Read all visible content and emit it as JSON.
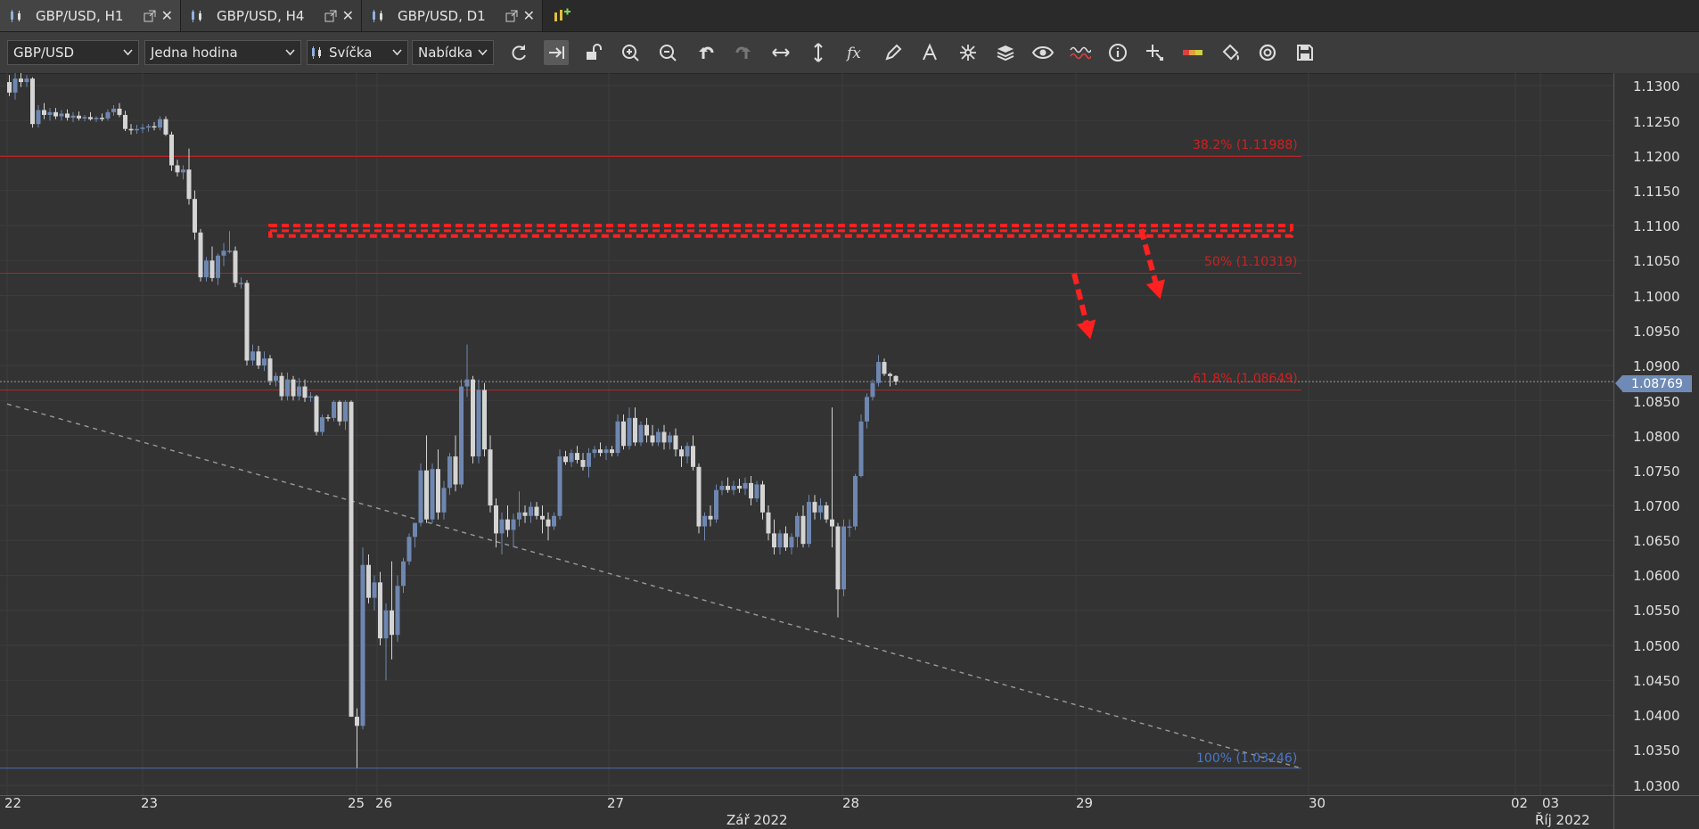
{
  "tabs": [
    {
      "label": "GBP/USD, H1",
      "active": true
    },
    {
      "label": "GBP/USD, H4",
      "active": false
    },
    {
      "label": "GBP/USD, D1",
      "active": false
    }
  ],
  "toolbar": {
    "symbol": "GBP/USD",
    "timeframe": "Jedna hodina",
    "chart_type": "Svíčka",
    "price_type": "Nabídka",
    "tools": [
      "refresh-icon",
      "autoscroll-icon",
      "lock-icon",
      "zoom-in-icon",
      "zoom-out-icon",
      "undo-icon",
      "redo-icon",
      "horizontal-resize-icon",
      "vertical-resize-icon",
      "indicator-fx-icon",
      "pencil-icon",
      "text-icon",
      "crosshair-star-icon",
      "layers-icon",
      "eye-icon",
      "waves-icon",
      "info-icon",
      "cursor-cross-icon",
      "color-bar-icon",
      "paint-bucket-icon",
      "camera-icon",
      "save-icon"
    ]
  },
  "price_axis": {
    "labels": [
      "1.1300",
      "1.1250",
      "1.1200",
      "1.1150",
      "1.1100",
      "1.1050",
      "1.1000",
      "1.0950",
      "1.0900",
      "1.0850",
      "1.0800",
      "1.0750",
      "1.0700",
      "1.0650",
      "1.0600",
      "1.0550",
      "1.0500",
      "1.0450",
      "1.0400",
      "1.0350",
      "1.0300"
    ],
    "current_price": "1.08769"
  },
  "time_axis": {
    "labels": [
      "22",
      "23",
      "25",
      "26",
      "27",
      "28",
      "29",
      "30",
      "02",
      "03"
    ],
    "months": [
      "Zář 2022",
      "Říj 2022"
    ]
  },
  "fib_labels": {
    "f382": "38.2% (1.11988)",
    "f50": "50% (1.10319)",
    "f618": "61.8% (1.08649)",
    "f100": "100% (1.03246)"
  },
  "colors": {
    "background": "#333333",
    "bull": "#6e87b0",
    "bear": "#d4d4d4",
    "fib": "#cc2222",
    "resistance": "#ff2020",
    "fib100": "#4a78c8",
    "trendline": "#9a9a9a"
  },
  "chart_data": {
    "type": "candlestick",
    "ylim": [
      1.0285,
      1.1325
    ],
    "x_domain": [
      "22",
      "03"
    ],
    "fib_levels": [
      1.11988,
      1.10319,
      1.08649,
      1.03246
    ],
    "resistance_zone": [
      1.1085,
      1.11
    ],
    "trendline": {
      "from": {
        "i": 0,
        "p": 1.0845
      },
      "to": {
        "i": 184,
        "p": 1.0325
      }
    },
    "candles": [
      {
        "o": 1.1305,
        "h": 1.1315,
        "l": 1.1285,
        "c": 1.129
      },
      {
        "o": 1.129,
        "h": 1.1318,
        "l": 1.128,
        "c": 1.131
      },
      {
        "o": 1.131,
        "h": 1.1318,
        "l": 1.1298,
        "c": 1.1305
      },
      {
        "o": 1.1305,
        "h": 1.1315,
        "l": 1.1298,
        "c": 1.131
      },
      {
        "o": 1.131,
        "h": 1.1312,
        "l": 1.124,
        "c": 1.1245
      },
      {
        "o": 1.1245,
        "h": 1.1272,
        "l": 1.124,
        "c": 1.1265
      },
      {
        "o": 1.1265,
        "h": 1.1275,
        "l": 1.1252,
        "c": 1.1258
      },
      {
        "o": 1.1258,
        "h": 1.1268,
        "l": 1.125,
        "c": 1.1262
      },
      {
        "o": 1.1262,
        "h": 1.1268,
        "l": 1.1252,
        "c": 1.1256
      },
      {
        "o": 1.1256,
        "h": 1.1265,
        "l": 1.125,
        "c": 1.126
      },
      {
        "o": 1.126,
        "h": 1.1266,
        "l": 1.125,
        "c": 1.1254
      },
      {
        "o": 1.1254,
        "h": 1.1262,
        "l": 1.1248,
        "c": 1.1257
      },
      {
        "o": 1.1257,
        "h": 1.1263,
        "l": 1.125,
        "c": 1.1253
      },
      {
        "o": 1.1253,
        "h": 1.1258,
        "l": 1.1249,
        "c": 1.1255
      },
      {
        "o": 1.1255,
        "h": 1.1262,
        "l": 1.125,
        "c": 1.1252
      },
      {
        "o": 1.1252,
        "h": 1.1256,
        "l": 1.1248,
        "c": 1.1254
      },
      {
        "o": 1.1254,
        "h": 1.126,
        "l": 1.1249,
        "c": 1.1253
      },
      {
        "o": 1.1253,
        "h": 1.1266,
        "l": 1.125,
        "c": 1.1262
      },
      {
        "o": 1.1262,
        "h": 1.1272,
        "l": 1.1257,
        "c": 1.1267
      },
      {
        "o": 1.1267,
        "h": 1.1275,
        "l": 1.1255,
        "c": 1.1258
      },
      {
        "o": 1.1258,
        "h": 1.1264,
        "l": 1.1235,
        "c": 1.1238
      },
      {
        "o": 1.1238,
        "h": 1.1245,
        "l": 1.123,
        "c": 1.1236
      },
      {
        "o": 1.1236,
        "h": 1.1244,
        "l": 1.1231,
        "c": 1.1238
      },
      {
        "o": 1.1238,
        "h": 1.1245,
        "l": 1.1232,
        "c": 1.124
      },
      {
        "o": 1.124,
        "h": 1.1245,
        "l": 1.1234,
        "c": 1.1242
      },
      {
        "o": 1.1242,
        "h": 1.1248,
        "l": 1.1236,
        "c": 1.124
      },
      {
        "o": 1.124,
        "h": 1.1256,
        "l": 1.1236,
        "c": 1.1252
      },
      {
        "o": 1.1252,
        "h": 1.1256,
        "l": 1.1228,
        "c": 1.123
      },
      {
        "o": 1.123,
        "h": 1.1234,
        "l": 1.1178,
        "c": 1.1186
      },
      {
        "o": 1.1186,
        "h": 1.1194,
        "l": 1.117,
        "c": 1.1176
      },
      {
        "o": 1.1176,
        "h": 1.1186,
        "l": 1.1166,
        "c": 1.118
      },
      {
        "o": 1.118,
        "h": 1.121,
        "l": 1.113,
        "c": 1.1138
      },
      {
        "o": 1.1138,
        "h": 1.115,
        "l": 1.108,
        "c": 1.109
      },
      {
        "o": 1.109,
        "h": 1.1095,
        "l": 1.102,
        "c": 1.1026
      },
      {
        "o": 1.1026,
        "h": 1.1055,
        "l": 1.102,
        "c": 1.105
      },
      {
        "o": 1.105,
        "h": 1.107,
        "l": 1.102,
        "c": 1.1025
      },
      {
        "o": 1.1025,
        "h": 1.106,
        "l": 1.1015,
        "c": 1.1057
      },
      {
        "o": 1.1057,
        "h": 1.1075,
        "l": 1.1042,
        "c": 1.1064
      },
      {
        "o": 1.1064,
        "h": 1.1092,
        "l": 1.106,
        "c": 1.1064
      },
      {
        "o": 1.1064,
        "h": 1.107,
        "l": 1.1012,
        "c": 1.1018
      },
      {
        "o": 1.1018,
        "h": 1.1026,
        "l": 1.101,
        "c": 1.1018
      },
      {
        "o": 1.1018,
        "h": 1.1022,
        "l": 1.09,
        "c": 1.0907
      },
      {
        "o": 1.0907,
        "h": 1.093,
        "l": 1.09,
        "c": 1.092
      },
      {
        "o": 1.092,
        "h": 1.0928,
        "l": 1.0895,
        "c": 1.09
      },
      {
        "o": 1.09,
        "h": 1.092,
        "l": 1.0892,
        "c": 1.091
      },
      {
        "o": 1.091,
        "h": 1.0915,
        "l": 1.0872,
        "c": 1.0878
      },
      {
        "o": 1.0878,
        "h": 1.089,
        "l": 1.087,
        "c": 1.0885
      },
      {
        "o": 1.0885,
        "h": 1.089,
        "l": 1.085,
        "c": 1.0856
      },
      {
        "o": 1.0856,
        "h": 1.089,
        "l": 1.085,
        "c": 1.088
      },
      {
        "o": 1.088,
        "h": 1.0885,
        "l": 1.085,
        "c": 1.0856
      },
      {
        "o": 1.0856,
        "h": 1.0882,
        "l": 1.085,
        "c": 1.087
      },
      {
        "o": 1.087,
        "h": 1.088,
        "l": 1.0848,
        "c": 1.0854
      },
      {
        "o": 1.0854,
        "h": 1.0862,
        "l": 1.0848,
        "c": 1.0856
      },
      {
        "o": 1.0856,
        "h": 1.0858,
        "l": 1.08,
        "c": 1.0805
      },
      {
        "o": 1.0805,
        "h": 1.083,
        "l": 1.08,
        "c": 1.0826
      },
      {
        "o": 1.0826,
        "h": 1.083,
        "l": 1.082,
        "c": 1.0825
      },
      {
        "o": 1.0825,
        "h": 1.085,
        "l": 1.082,
        "c": 1.0848
      },
      {
        "o": 1.0848,
        "h": 1.085,
        "l": 1.0814,
        "c": 1.082
      },
      {
        "o": 1.082,
        "h": 1.085,
        "l": 1.0808,
        "c": 1.0848
      },
      {
        "o": 1.0848,
        "h": 1.085,
        "l": 1.0398,
        "c": 1.0398
      },
      {
        "o": 1.0398,
        "h": 1.041,
        "l": 1.0325,
        "c": 1.0385
      },
      {
        "o": 1.0385,
        "h": 1.064,
        "l": 1.038,
        "c": 1.0615
      },
      {
        "o": 1.0615,
        "h": 1.063,
        "l": 1.056,
        "c": 1.0568
      },
      {
        "o": 1.0568,
        "h": 1.06,
        "l": 1.055,
        "c": 1.059
      },
      {
        "o": 1.059,
        "h": 1.0605,
        "l": 1.05,
        "c": 1.051
      },
      {
        "o": 1.051,
        "h": 1.056,
        "l": 1.045,
        "c": 1.055
      },
      {
        "o": 1.055,
        "h": 1.062,
        "l": 1.048,
        "c": 1.0515
      },
      {
        "o": 1.0515,
        "h": 1.06,
        "l": 1.0505,
        "c": 1.0585
      },
      {
        "o": 1.0585,
        "h": 1.0625,
        "l": 1.0575,
        "c": 1.062
      },
      {
        "o": 1.062,
        "h": 1.066,
        "l": 1.0615,
        "c": 1.0655
      },
      {
        "o": 1.0655,
        "h": 1.0675,
        "l": 1.064,
        "c": 1.0675
      },
      {
        "o": 1.0675,
        "h": 1.076,
        "l": 1.067,
        "c": 1.075
      },
      {
        "o": 1.075,
        "h": 1.08,
        "l": 1.0675,
        "c": 1.068
      },
      {
        "o": 1.068,
        "h": 1.076,
        "l": 1.0675,
        "c": 1.0752
      },
      {
        "o": 1.0752,
        "h": 1.078,
        "l": 1.068,
        "c": 1.069
      },
      {
        "o": 1.069,
        "h": 1.0735,
        "l": 1.068,
        "c": 1.0725
      },
      {
        "o": 1.0725,
        "h": 1.0775,
        "l": 1.0715,
        "c": 1.077
      },
      {
        "o": 1.077,
        "h": 1.08,
        "l": 1.072,
        "c": 1.073
      },
      {
        "o": 1.073,
        "h": 1.088,
        "l": 1.0725,
        "c": 1.087
      },
      {
        "o": 1.087,
        "h": 1.093,
        "l": 1.0855,
        "c": 1.088
      },
      {
        "o": 1.088,
        "h": 1.0885,
        "l": 1.076,
        "c": 1.077
      },
      {
        "o": 1.077,
        "h": 1.088,
        "l": 1.076,
        "c": 1.0865
      },
      {
        "o": 1.0865,
        "h": 1.0875,
        "l": 1.077,
        "c": 1.078
      },
      {
        "o": 1.078,
        "h": 1.08,
        "l": 1.069,
        "c": 1.07
      },
      {
        "o": 1.07,
        "h": 1.071,
        "l": 1.064,
        "c": 1.066
      },
      {
        "o": 1.066,
        "h": 1.069,
        "l": 1.063,
        "c": 1.068
      },
      {
        "o": 1.068,
        "h": 1.07,
        "l": 1.0655,
        "c": 1.0665
      },
      {
        "o": 1.0665,
        "h": 1.0688,
        "l": 1.064,
        "c": 1.068
      },
      {
        "o": 1.068,
        "h": 1.072,
        "l": 1.067,
        "c": 1.069
      },
      {
        "o": 1.069,
        "h": 1.07,
        "l": 1.0675,
        "c": 1.0685
      },
      {
        "o": 1.0685,
        "h": 1.0705,
        "l": 1.0675,
        "c": 1.0698
      },
      {
        "o": 1.0698,
        "h": 1.0705,
        "l": 1.068,
        "c": 1.0685
      },
      {
        "o": 1.0685,
        "h": 1.07,
        "l": 1.066,
        "c": 1.068
      },
      {
        "o": 1.068,
        "h": 1.069,
        "l": 1.065,
        "c": 1.067
      },
      {
        "o": 1.067,
        "h": 1.069,
        "l": 1.0665,
        "c": 1.0685
      },
      {
        "o": 1.0685,
        "h": 1.078,
        "l": 1.068,
        "c": 1.077
      },
      {
        "o": 1.077,
        "h": 1.0778,
        "l": 1.0758,
        "c": 1.0762
      },
      {
        "o": 1.0762,
        "h": 1.078,
        "l": 1.0755,
        "c": 1.0775
      },
      {
        "o": 1.0775,
        "h": 1.0785,
        "l": 1.076,
        "c": 1.0765
      },
      {
        "o": 1.0765,
        "h": 1.0775,
        "l": 1.075,
        "c": 1.0755
      },
      {
        "o": 1.0755,
        "h": 1.0782,
        "l": 1.074,
        "c": 1.0775
      },
      {
        "o": 1.0775,
        "h": 1.0785,
        "l": 1.0768,
        "c": 1.078
      },
      {
        "o": 1.078,
        "h": 1.079,
        "l": 1.077,
        "c": 1.0775
      },
      {
        "o": 1.0775,
        "h": 1.0785,
        "l": 1.0765,
        "c": 1.078
      },
      {
        "o": 1.078,
        "h": 1.0785,
        "l": 1.077,
        "c": 1.0775
      },
      {
        "o": 1.0775,
        "h": 1.083,
        "l": 1.077,
        "c": 1.082
      },
      {
        "o": 1.082,
        "h": 1.083,
        "l": 1.078,
        "c": 1.0785
      },
      {
        "o": 1.0785,
        "h": 1.084,
        "l": 1.078,
        "c": 1.0825
      },
      {
        "o": 1.0825,
        "h": 1.084,
        "l": 1.0785,
        "c": 1.079
      },
      {
        "o": 1.079,
        "h": 1.082,
        "l": 1.0785,
        "c": 1.0815
      },
      {
        "o": 1.0815,
        "h": 1.0825,
        "l": 1.079,
        "c": 1.08
      },
      {
        "o": 1.08,
        "h": 1.0815,
        "l": 1.0785,
        "c": 1.079
      },
      {
        "o": 1.079,
        "h": 1.081,
        "l": 1.0785,
        "c": 1.0805
      },
      {
        "o": 1.0805,
        "h": 1.0815,
        "l": 1.078,
        "c": 1.079
      },
      {
        "o": 1.079,
        "h": 1.0805,
        "l": 1.078,
        "c": 1.08
      },
      {
        "o": 1.08,
        "h": 1.081,
        "l": 1.077,
        "c": 1.078
      },
      {
        "o": 1.078,
        "h": 1.0785,
        "l": 1.0755,
        "c": 1.077
      },
      {
        "o": 1.077,
        "h": 1.079,
        "l": 1.076,
        "c": 1.0785
      },
      {
        "o": 1.0785,
        "h": 1.08,
        "l": 1.075,
        "c": 1.0755
      },
      {
        "o": 1.0755,
        "h": 1.076,
        "l": 1.066,
        "c": 1.067
      },
      {
        "o": 1.067,
        "h": 1.069,
        "l": 1.065,
        "c": 1.0685
      },
      {
        "o": 1.0685,
        "h": 1.07,
        "l": 1.067,
        "c": 1.068
      },
      {
        "o": 1.068,
        "h": 1.073,
        "l": 1.0675,
        "c": 1.0722
      },
      {
        "o": 1.0722,
        "h": 1.0735,
        "l": 1.0715,
        "c": 1.0728
      },
      {
        "o": 1.0728,
        "h": 1.074,
        "l": 1.0718,
        "c": 1.0722
      },
      {
        "o": 1.0722,
        "h": 1.0735,
        "l": 1.0715,
        "c": 1.0728
      },
      {
        "o": 1.0728,
        "h": 1.0738,
        "l": 1.0718,
        "c": 1.0724
      },
      {
        "o": 1.0724,
        "h": 1.074,
        "l": 1.0715,
        "c": 1.0732
      },
      {
        "o": 1.0732,
        "h": 1.0742,
        "l": 1.07,
        "c": 1.071
      },
      {
        "o": 1.071,
        "h": 1.0735,
        "l": 1.0705,
        "c": 1.073
      },
      {
        "o": 1.073,
        "h": 1.0735,
        "l": 1.068,
        "c": 1.069
      },
      {
        "o": 1.069,
        "h": 1.07,
        "l": 1.065,
        "c": 1.066
      },
      {
        "o": 1.066,
        "h": 1.068,
        "l": 1.063,
        "c": 1.064
      },
      {
        "o": 1.064,
        "h": 1.0665,
        "l": 1.063,
        "c": 1.066
      },
      {
        "o": 1.066,
        "h": 1.067,
        "l": 1.0635,
        "c": 1.064
      },
      {
        "o": 1.064,
        "h": 1.066,
        "l": 1.063,
        "c": 1.0655
      },
      {
        "o": 1.0655,
        "h": 1.069,
        "l": 1.064,
        "c": 1.0685
      },
      {
        "o": 1.0685,
        "h": 1.07,
        "l": 1.064,
        "c": 1.0645
      },
      {
        "o": 1.0645,
        "h": 1.0715,
        "l": 1.064,
        "c": 1.0705
      },
      {
        "o": 1.0705,
        "h": 1.0715,
        "l": 1.068,
        "c": 1.069
      },
      {
        "o": 1.069,
        "h": 1.071,
        "l": 1.068,
        "c": 1.07
      },
      {
        "o": 1.07,
        "h": 1.0705,
        "l": 1.0675,
        "c": 1.068
      },
      {
        "o": 1.068,
        "h": 1.084,
        "l": 1.064,
        "c": 1.067
      },
      {
        "o": 1.067,
        "h": 1.0675,
        "l": 1.054,
        "c": 1.058
      },
      {
        "o": 1.058,
        "h": 1.068,
        "l": 1.057,
        "c": 1.067
      },
      {
        "o": 1.067,
        "h": 1.068,
        "l": 1.0655,
        "c": 1.067
      },
      {
        "o": 1.067,
        "h": 1.0745,
        "l": 1.0665,
        "c": 1.0742
      },
      {
        "o": 1.0742,
        "h": 1.083,
        "l": 1.074,
        "c": 1.082
      },
      {
        "o": 1.082,
        "h": 1.086,
        "l": 1.081,
        "c": 1.0855
      },
      {
        "o": 1.0855,
        "h": 1.088,
        "l": 1.085,
        "c": 1.0875
      },
      {
        "o": 1.0875,
        "h": 1.0915,
        "l": 1.087,
        "c": 1.0905
      },
      {
        "o": 1.0905,
        "h": 1.091,
        "l": 1.0885,
        "c": 1.0888
      },
      {
        "o": 1.0888,
        "h": 1.089,
        "l": 1.087,
        "c": 1.0885
      },
      {
        "o": 1.0885,
        "h": 1.0886,
        "l": 1.0872,
        "c": 1.0877
      }
    ]
  }
}
